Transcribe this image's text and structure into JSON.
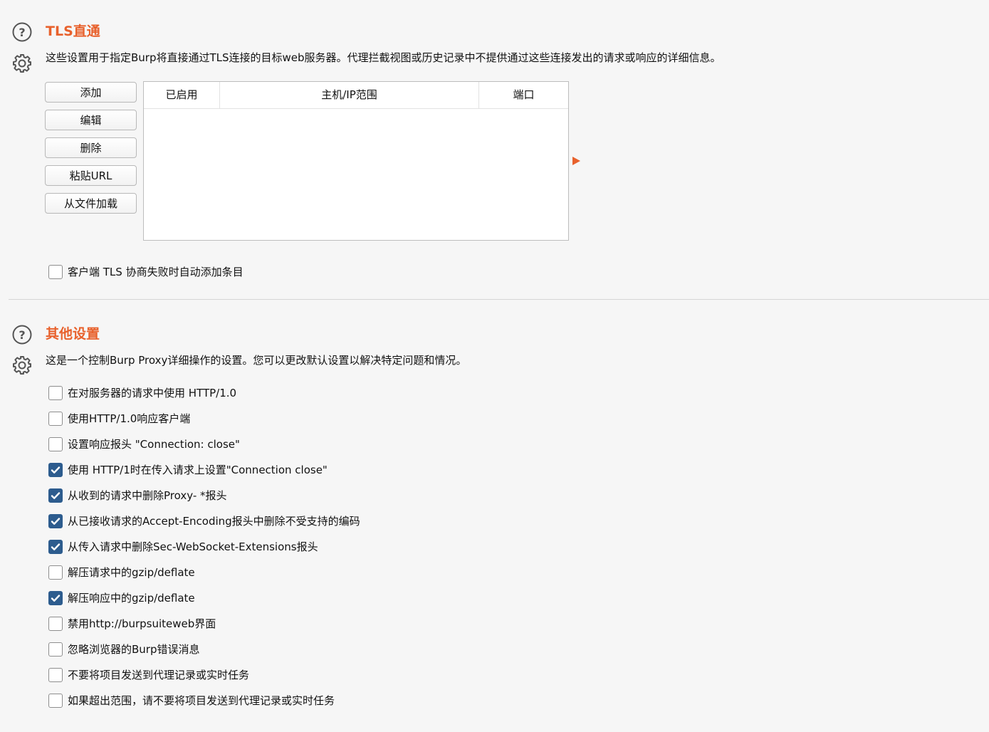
{
  "tls": {
    "title": "TLS直通",
    "description": "这些设置用于指定Burp将直接通过TLS连接的目标web服务器。代理拦截视图或历史记录中不提供通过这些连接发出的请求或响应的详细信息。",
    "buttons": [
      "添加",
      "编辑",
      "删除",
      "粘贴URL",
      "从文件加载"
    ],
    "table": {
      "columns": [
        "已启用",
        "主机/IP范围",
        "端口"
      ],
      "rows": []
    },
    "auto_add": {
      "label": "客户端 TLS 协商失败时自动添加条目",
      "checked": false
    }
  },
  "misc": {
    "title": "其他设置",
    "description": "这是一个控制Burp Proxy详细操作的设置。您可以更改默认设置以解决特定问题和情况。",
    "options": [
      {
        "label": "在对服务器的请求中使用 HTTP/1.0",
        "checked": false
      },
      {
        "label": "使用HTTP/1.0响应客户端",
        "checked": false
      },
      {
        "label": "设置响应报头 \"Connection: close\"",
        "checked": false
      },
      {
        "label": "使用 HTTP/1时在传入请求上设置\"Connection close\"",
        "checked": true
      },
      {
        "label": "从收到的请求中删除Proxy- *报头",
        "checked": true
      },
      {
        "label": "从已接收请求的Accept-Encoding报头中删除不受支持的编码",
        "checked": true
      },
      {
        "label": "从传入请求中删除Sec-WebSocket-Extensions报头",
        "checked": true
      },
      {
        "label": "解压请求中的gzip/deflate",
        "checked": false
      },
      {
        "label": "解压响应中的gzip/deflate",
        "checked": true
      },
      {
        "label": "禁用http://burpsuiteweb界面",
        "checked": false
      },
      {
        "label": "忽略浏览器的Burp错误消息",
        "checked": false
      },
      {
        "label": "不要将项目发送到代理记录或实时任务",
        "checked": false
      },
      {
        "label": "如果超出范围，请不要将项目发送到代理记录或实时任务",
        "checked": false
      }
    ]
  },
  "icons": {
    "help": "help-circle-icon",
    "settings": "gear-icon",
    "expand": "triangle-right-icon"
  },
  "colors": {
    "accent": "#e8612c",
    "checkbox_checked": "#2d5c8e",
    "background": "#f6f6f6"
  }
}
